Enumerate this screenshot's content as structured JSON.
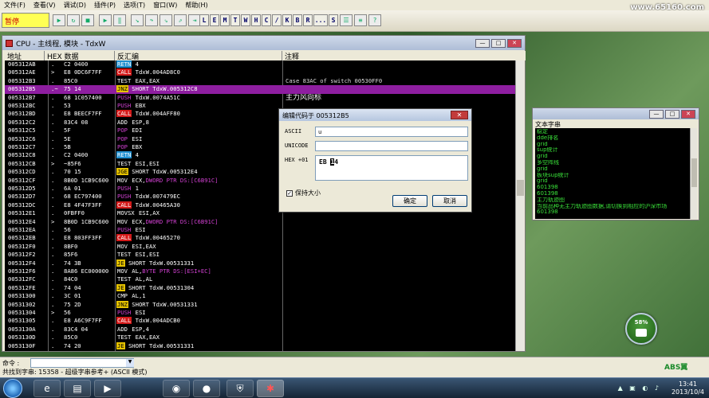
{
  "menubar": {
    "items": [
      "文件(F)",
      "查看(V)",
      "调试(D)",
      "插件(P)",
      "选项(T)",
      "窗口(W)",
      "帮助(H)"
    ],
    "watermark": "www.65160.com"
  },
  "toolbar": {
    "status": "暂停",
    "letters": [
      "L",
      "E",
      "M",
      "T",
      "W",
      "H",
      "C",
      "/",
      "K",
      "B",
      "R",
      "...",
      "S"
    ]
  },
  "cpu": {
    "title": "CPU - 主线程, 模块 - TdxW",
    "columns": [
      "地址",
      "HEX 数据",
      "反汇编",
      "注释"
    ],
    "rows": [
      {
        "addr": "005312AB",
        "sym": ".",
        "hex": "C2 0400",
        "mn": "RETN",
        "mt": "ret",
        "ops": " 4",
        "cmt": ""
      },
      {
        "addr": "005312AE",
        "sym": ">",
        "hex": "E8 0DC6F7FF",
        "mn": "CALL",
        "mt": "call",
        "ops": " TdxW.004AD8C0",
        "cmt": ""
      },
      {
        "addr": "005312B3",
        "sym": ".",
        "hex": "85C0",
        "mn": "TEST",
        "mt": "",
        "ops": " EAX,EAX",
        "cmt": "Case 83AC of switch 00530FF0"
      },
      {
        "addr": "005312B5",
        "sym": ".~",
        "hex": "75 14",
        "mn": "JNZ",
        "mt": "jmp",
        "ops": " SHORT TdxW.005312C8",
        "cmt": "",
        "sel": true
      },
      {
        "addr": "005312B7",
        "sym": ".",
        "hex": "68 1C057400",
        "mn": "PUSH",
        "mt": "push",
        "ops": " TdxW.0074A51C",
        "cmt": "主力风向标",
        "big": true
      },
      {
        "addr": "005312BC",
        "sym": ".",
        "hex": "53",
        "mn": "PUSH",
        "mt": "push",
        "ops": " EBX",
        "cmt": ""
      },
      {
        "addr": "005312BD",
        "sym": ".",
        "hex": "E8 BEECF7FF",
        "mn": "CALL",
        "mt": "call",
        "ops": " TdxW.004AFF80",
        "cmt": ""
      },
      {
        "addr": "005312C2",
        "sym": ".",
        "hex": "83C4 08",
        "mn": "ADD",
        "mt": "",
        "ops": " ESP,8",
        "cmt": ""
      },
      {
        "addr": "005312C5",
        "sym": ".",
        "hex": "5F",
        "mn": "POP",
        "mt": "pop",
        "ops": " EDI",
        "cmt": ""
      },
      {
        "addr": "005312C6",
        "sym": ".",
        "hex": "5E",
        "mn": "POP",
        "mt": "pop",
        "ops": " ESI",
        "cmt": ""
      },
      {
        "addr": "005312C7",
        "sym": ".",
        "hex": "5B",
        "mn": "POP",
        "mt": "pop",
        "ops": " EBX",
        "cmt": ""
      },
      {
        "addr": "005312C8",
        "sym": ".",
        "hex": "C2 0400",
        "mn": "RETN",
        "mt": "ret",
        "ops": " 4",
        "cmt": ""
      },
      {
        "addr": "005312CB",
        "sym": ">",
        "hex": "~85F6",
        "mn": "TEST",
        "mt": "",
        "ops": " ESI,ESI",
        "cmt": ""
      },
      {
        "addr": "005312CD",
        "sym": ".",
        "hex": "70 15",
        "mn": "JGE",
        "mt": "jmp",
        "ops": " SHORT TdxW.005312E4",
        "cmt": ""
      },
      {
        "addr": "005312CF",
        "sym": ".",
        "hex": "8B0D 1CB9C600",
        "mn": "MOV",
        "mt": "",
        "ops": " ECX,",
        "ptr": "DWORD PTR DS:[C6B91C]",
        "cmt": ""
      },
      {
        "addr": "005312D5",
        "sym": ".",
        "hex": "6A 01",
        "mn": "PUSH",
        "mt": "push",
        "ops": " 1",
        "cmt": ""
      },
      {
        "addr": "005312D7",
        "sym": ".",
        "hex": "68 EC797400",
        "mn": "PUSH",
        "mt": "push",
        "ops": " TdxW.007479EC",
        "cmt": ""
      },
      {
        "addr": "005312DC",
        "sym": ".",
        "hex": "E8 4F47F3FF",
        "mn": "CALL",
        "mt": "call",
        "ops": " TdxW.00465A30",
        "cmt": ""
      },
      {
        "addr": "005312E1",
        "sym": ".",
        "hex": "0FBFF0",
        "mn": "MOVSX",
        "mt": "",
        "ops": " ESI,AX",
        "cmt": ""
      },
      {
        "addr": "005312E4",
        "sym": ">",
        "hex": "8B0D 1CB9C600",
        "mn": "MOV",
        "mt": "",
        "ops": " ECX,",
        "ptr": "DWORD PTR DS:[C6B91C]",
        "cmt": ""
      },
      {
        "addr": "005312EA",
        "sym": ".",
        "hex": "56",
        "mn": "PUSH",
        "mt": "push",
        "ops": " ESI",
        "cmt": ""
      },
      {
        "addr": "005312EB",
        "sym": ".",
        "hex": "E8 803FF3FF",
        "mn": "CALL",
        "mt": "call",
        "ops": " TdxW.00465270",
        "cmt": ""
      },
      {
        "addr": "005312F0",
        "sym": ".",
        "hex": "8BF0",
        "mn": "MOV",
        "mt": "",
        "ops": " ESI,EAX",
        "cmt": ""
      },
      {
        "addr": "005312F2",
        "sym": ".",
        "hex": "85F6",
        "mn": "TEST",
        "mt": "",
        "ops": " ESI,ESI",
        "cmt": ""
      },
      {
        "addr": "005312F4",
        "sym": ".",
        "hex": "74 3B",
        "mn": "JE",
        "mt": "jmp",
        "ops": " SHORT TdxW.00531331",
        "cmt": ""
      },
      {
        "addr": "005312F6",
        "sym": ".",
        "hex": "8A86 EC000000",
        "mn": "MOV",
        "mt": "",
        "ops": " AL,",
        "ptr": "BYTE PTR DS:[ESI+EC]",
        "cmt": ""
      },
      {
        "addr": "005312FC",
        "sym": ".",
        "hex": "84C0",
        "mn": "TEST",
        "mt": "",
        "ops": " AL,AL",
        "cmt": ""
      },
      {
        "addr": "005312FE",
        "sym": ".",
        "hex": "74 04",
        "mn": "JE",
        "mt": "jmp",
        "ops": " SHORT TdxW.00531304",
        "cmt": ""
      },
      {
        "addr": "00531300",
        "sym": ".",
        "hex": "3C 01",
        "mn": "CMP",
        "mt": "",
        "ops": " AL,1",
        "cmt": ""
      },
      {
        "addr": "00531302",
        "sym": ".",
        "hex": "75 2D",
        "mn": "JNZ",
        "mt": "jmp",
        "ops": " SHORT TdxW.00531331",
        "cmt": ""
      },
      {
        "addr": "00531304",
        "sym": ">",
        "hex": "56",
        "mn": "PUSH",
        "mt": "push",
        "ops": " ESI",
        "cmt": ""
      },
      {
        "addr": "00531305",
        "sym": ".",
        "hex": "E8 A6C9F7FF",
        "mn": "CALL",
        "mt": "call",
        "ops": " TdxW.004ADCB0",
        "cmt": ""
      },
      {
        "addr": "0053130A",
        "sym": ".",
        "hex": "83C4 04",
        "mn": "ADD",
        "mt": "",
        "ops": " ESP,4",
        "cmt": ""
      },
      {
        "addr": "0053130D",
        "sym": ".",
        "hex": "85C0",
        "mn": "TEST",
        "mt": "",
        "ops": " EAX,EAX",
        "cmt": ""
      },
      {
        "addr": "0053130F",
        "sym": ".",
        "hex": "74 20",
        "mn": "JE",
        "mt": "jmp",
        "ops": " SHORT TdxW.00531331",
        "cmt": ""
      }
    ]
  },
  "dialog": {
    "title": "编辑代码于 005312B5",
    "close": "✕",
    "ascii_label": "ASCII",
    "ascii_value": "u",
    "unicode_label": "UNICODE",
    "unicode_value": "",
    "hex_label": "HEX +01",
    "hex_prefix": "EB ",
    "hex_cursor": "1",
    "hex_suffix": "4",
    "keep_size": "保持大小",
    "ok": "确定",
    "cancel": "取消"
  },
  "strings": {
    "label": "文本字串",
    "items": [
      "稳定",
      "dde排名",
      "grid",
      "sup统计",
      "grid",
      "多空阵线",
      "grid",
      "板块sup统计",
      "grid",
      "601398",
      "601398",
      "主力轨迹图",
      "当前品种无主力轨迹图数据,请切换到相应的沪深市场",
      "601398"
    ]
  },
  "gadget": {
    "battery_pct": "58%"
  },
  "cmdbar": {
    "label": "命令 :"
  },
  "statusbar": {
    "text": "共找到字串: 15358  - 超级字串参考+ (ASCII 模式)"
  },
  "logo_corner": "ABS翼",
  "clock": {
    "time": "13:41",
    "date": "2013/10/4"
  }
}
